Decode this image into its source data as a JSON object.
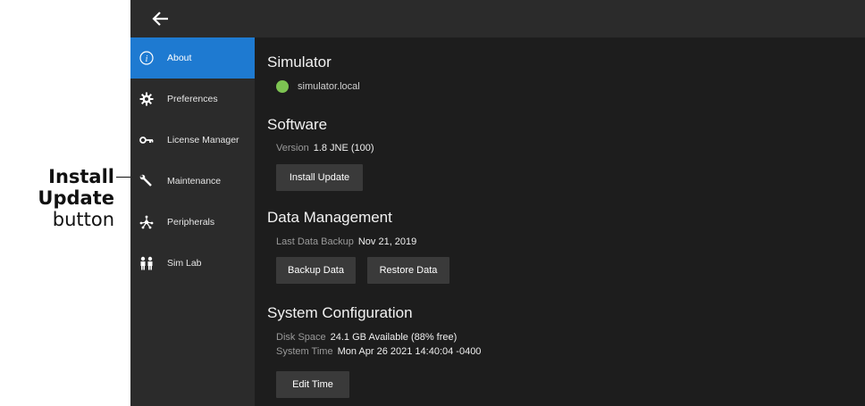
{
  "callout": {
    "line1": "Install",
    "line2": "Update",
    "line3": "button"
  },
  "topbar": {
    "back_icon": "back-arrow-icon"
  },
  "sidebar": {
    "items": [
      {
        "label": "About",
        "icon": "info-icon",
        "active": true
      },
      {
        "label": "Preferences",
        "icon": "gear-icon"
      },
      {
        "label": "License Manager",
        "icon": "key-icon"
      },
      {
        "label": "Maintenance",
        "icon": "wrench-icon"
      },
      {
        "label": "Peripherals",
        "icon": "network-icon"
      },
      {
        "label": "Sim Lab",
        "icon": "people-icon"
      }
    ]
  },
  "main": {
    "simulator": {
      "title": "Simulator",
      "host": "simulator.local",
      "status_color": "#7dc352"
    },
    "software": {
      "title": "Software",
      "version_label": "Version",
      "version_value": "1.8 JNE (100)",
      "install_button": "Install Update"
    },
    "data_management": {
      "title": "Data Management",
      "backup_label": "Last Data Backup",
      "backup_value": "Nov 21, 2019",
      "backup_button": "Backup Data",
      "restore_button": "Restore Data"
    },
    "system_configuration": {
      "title": "System Configuration",
      "disk_label": "Disk Space",
      "disk_value": "24.1 GB Available (88% free)",
      "time_label": "System Time",
      "time_value": "Mon Apr 26 2021 14:40:04 -0400",
      "edit_time_button": "Edit Time"
    }
  },
  "colors": {
    "accent": "#1e7ad1",
    "background": "#1d1d1d",
    "sidebar": "#2b2b2b",
    "button": "#3a3a3a"
  }
}
